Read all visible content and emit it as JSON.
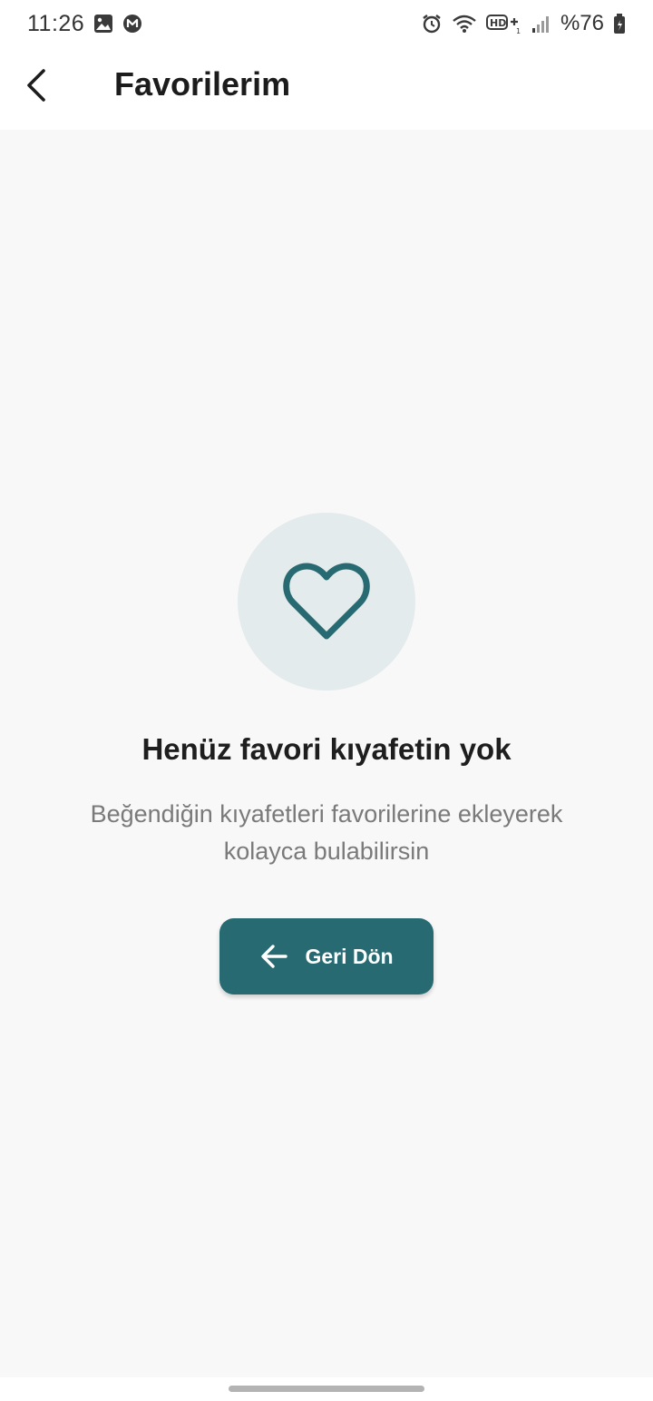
{
  "status_bar": {
    "time": "11:26",
    "battery": "%76",
    "icons_left": [
      "gallery-icon",
      "m-app-icon"
    ],
    "icons_right": [
      "alarm-icon",
      "wifi-icon",
      "hd-volte-icon",
      "signal-icon",
      "battery-icon"
    ]
  },
  "app_bar": {
    "title": "Favorilerim",
    "back_icon": "chevron-left-icon"
  },
  "empty_state": {
    "icon": "heart-outline-icon",
    "title": "Henüz favori kıyafetin yok",
    "description": "Beğendiğin kıyafetleri favorilerine ekleyerek kolayca bulabilirsin",
    "button_label": "Geri Dön",
    "button_icon": "arrow-left-icon"
  },
  "colors": {
    "accent": "#276a72",
    "heart_circle_bg": "#e3ebec",
    "content_bg": "#f8f8f8"
  }
}
